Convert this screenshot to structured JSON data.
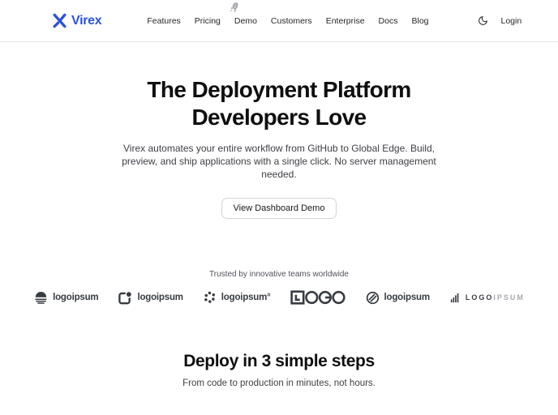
{
  "brand": {
    "name": "Virex",
    "color": "#2b52e0"
  },
  "header": {
    "nav_items": [
      "Features",
      "Pricing",
      "Demo",
      "Customers",
      "Enterprise",
      "Docs",
      "Blog"
    ],
    "login_label": "Login",
    "theme_toggle_icon": "moon-icon",
    "decoration_icon": "rocket-icon"
  },
  "hero": {
    "title_line1": "The Deployment Platform",
    "title_line2": "Developers Love",
    "subtitle": "Virex automates your entire workflow from GitHub to Global Edge. Build, preview, and ship applications with a single click. No server management needed.",
    "cta_label": "View Dashboard Demo"
  },
  "social_proof": {
    "caption": "Trusted by innovative teams worldwide",
    "logos": [
      {
        "icon": "globe-waves-icon",
        "label": "logoipsum"
      },
      {
        "icon": "frame-circle-icon",
        "label": "logoipsum"
      },
      {
        "icon": "dot-cluster-icon",
        "label": "logoipsum°"
      },
      {
        "icon": "logo-wordmark",
        "label": "LOGO"
      },
      {
        "icon": "slashed-circle-icon",
        "label": "logoipsum"
      },
      {
        "icon": "bars-play-icon",
        "label_dark": "LOGO",
        "label_light": "IPSUM"
      }
    ],
    "logo_color": "#373c42",
    "logo_muted_color": "#a6aab0"
  },
  "steps": {
    "title": "Deploy in 3 simple steps",
    "subtitle": "From code to production in minutes, not hours."
  }
}
